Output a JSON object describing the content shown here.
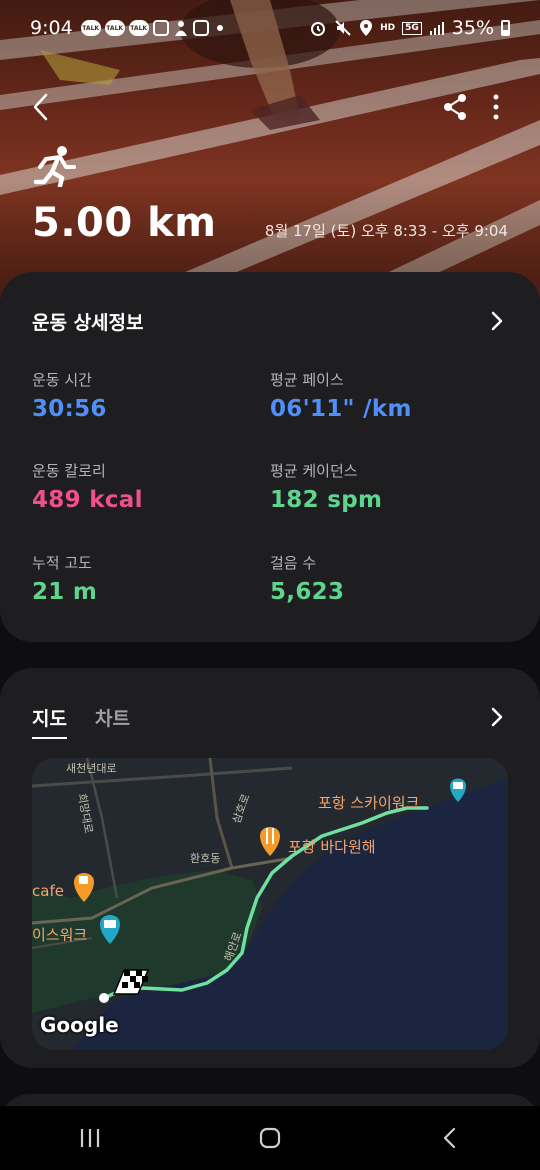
{
  "status_bar": {
    "time": "9:04",
    "battery": "35%",
    "notif_icons": [
      "talk-icon",
      "talk-icon",
      "talk-icon",
      "instagram-icon",
      "app-icon",
      "instagram-icon"
    ],
    "system_icons": [
      "alarm-icon",
      "mute-icon",
      "location-icon",
      "hd-voice-icon",
      "5g-icon",
      "signal-icon",
      "battery-icon"
    ],
    "hd_label": "HD",
    "net_label": "5G"
  },
  "header": {
    "distance": "5.00 km",
    "date_range": "8월 17일 (토) 오후 8:33 - 오후 9:04"
  },
  "detail_card": {
    "title": "운동 상세정보",
    "metrics": [
      {
        "label": "운동 시간",
        "value": "30:56",
        "color": "#4f8ff7"
      },
      {
        "label": "평균 페이스",
        "value": "06'11\" /km",
        "color": "#4f8ff7"
      },
      {
        "label": "운동 칼로리",
        "value": "489 kcal",
        "color": "#f0508a"
      },
      {
        "label": "평균 케이던스",
        "value": "182 spm",
        "color": "#5ed48f"
      },
      {
        "label": "누적 고도",
        "value": "21 m",
        "color": "#5ed48f"
      },
      {
        "label": "걸음 수",
        "value": "5,623",
        "color": "#5ed48f"
      }
    ]
  },
  "map_card": {
    "tabs": [
      {
        "label": "지도"
      },
      {
        "label": "차트"
      }
    ],
    "map_labels": {
      "road_top": "새천년대로",
      "road_vertical1": "희망대로",
      "road_vertical2": "삼호로",
      "district": "환호동",
      "road_coastal": "해안로",
      "place1": "포항 스카이워크",
      "place2": "포항 바다원해",
      "place3": "cafe",
      "place4": "이스워크",
      "google": "Google"
    },
    "route_color": "#6fe0a0"
  }
}
